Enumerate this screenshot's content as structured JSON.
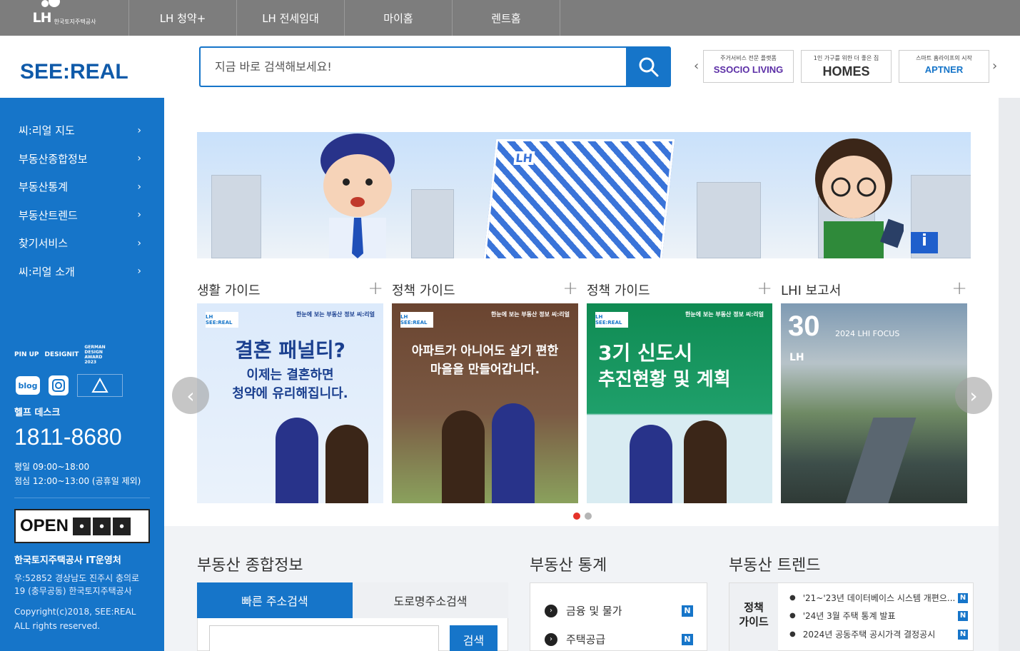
{
  "topnav": {
    "logo_text": "LH",
    "logo_sub": "한국토지주택공사",
    "items": [
      "LH 청약+",
      "LH 전세임대",
      "마이홈",
      "렌트홈"
    ]
  },
  "header": {
    "brand": "SEE:REAL",
    "search_placeholder": "지금 바로 검색해보세요!",
    "partners": [
      {
        "caption": "주거서비스 전문 플랫폼",
        "name": "SSOCIO LIVING"
      },
      {
        "caption": "1인 가구를 위한 더 좋은 집",
        "name": "HOMES"
      },
      {
        "caption": "스마트 홈라이프의 시작",
        "name": "APTNER"
      }
    ]
  },
  "sidebar": {
    "menu": [
      "씨:리얼 지도",
      "부동산종합정보",
      "부동산통계",
      "부동산트렌드",
      "찾기서비스",
      "씨:리얼 소개"
    ],
    "awards": [
      "PIN UP",
      "DESIGNIT",
      "GERMAN DESIGN AWARD 2023"
    ],
    "social_blog": "blog",
    "help_title": "헬프 데스크",
    "phone": "1811-8680",
    "hours1": "평일 09:00~18:00",
    "hours2": "점심 12:00~13:00 (공휴일 제외)",
    "open_label": "OPEN",
    "org": "한국토지주택공사 IT운영처",
    "addr1": "우:52852 경상남도 진주시 충의로",
    "addr2": "19 (충무공동) 한국토지주택공사",
    "copy1": "Copyright(c)2018, SEE:REAL",
    "copy2": "ALL rights reserved."
  },
  "banner": {
    "tower_label": "LH",
    "info_sign": "i"
  },
  "guides": [
    {
      "title": "생활 가이드",
      "tag": "한눈에 보는 부동산 정보 씨:리얼",
      "line1": "결혼 패널티?",
      "line2": "이제는 결혼하면",
      "line3": "청약에 유리해집니다."
    },
    {
      "title": "정책 가이드",
      "tag": "한눈에 보는 부동산 정보 씨:리얼",
      "line1": "아파트가 아니어도 살기 편한",
      "line2": "마을을 만들어갑니다."
    },
    {
      "title": "정책 가이드",
      "tag": "한눈에 보는 부동산 정보 씨:리얼",
      "line1": "3기 신도시",
      "line2": "추진현황 및 계획"
    },
    {
      "title": "LHI 보고서",
      "num": "30",
      "sub": "2024 LHI FOCUS",
      "brand": "LH"
    }
  ],
  "info": {
    "title": "부동산 종합정보",
    "tab1": "빠른 주소검색",
    "tab2": "도로명주소검색",
    "search_button": "검색"
  },
  "stats": {
    "title": "부동산 통계",
    "items": [
      "금융 및 물가",
      "주택공급"
    ],
    "badge": "N"
  },
  "trend": {
    "title": "부동산 트렌드",
    "label1": "정책",
    "label2": "가이드",
    "items": [
      "'21~'23년 데이터베이스 시스템 개편으...",
      "'24년 3월 주택 통계 발표",
      "2024년 공동주택 공시가격 결정공시"
    ],
    "badge": "N"
  },
  "colors": {
    "primary": "#1675c9",
    "topnav": "#7d7d7d",
    "active_dot": "#e5332a"
  }
}
